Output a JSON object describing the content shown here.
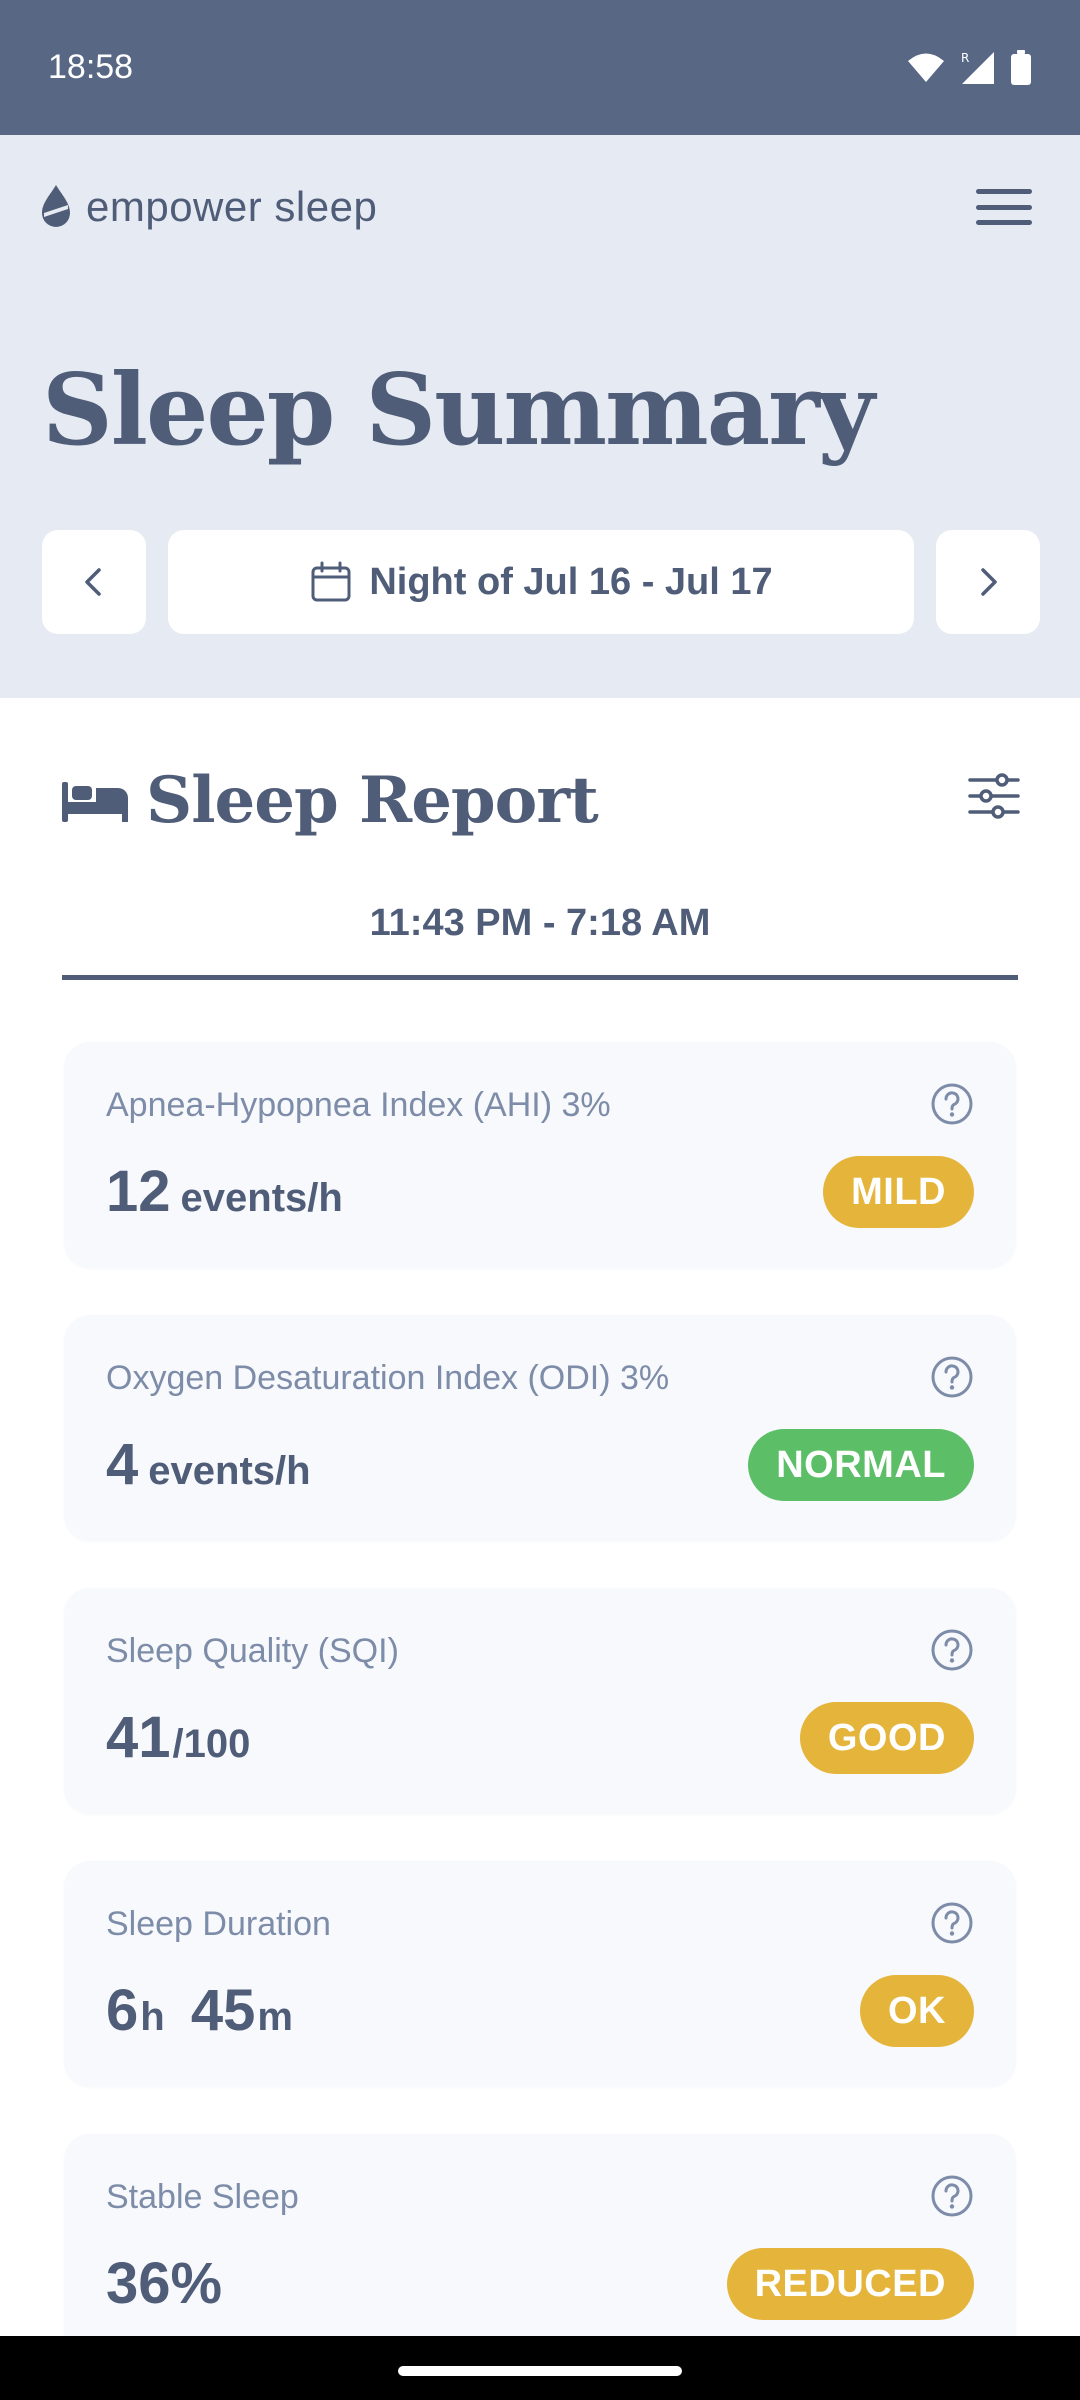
{
  "status_bar": {
    "time": "18:58"
  },
  "brand": {
    "name": "empower sleep"
  },
  "page": {
    "title": "Sleep Summary"
  },
  "date_nav": {
    "label": "Night of Jul 16 - Jul 17"
  },
  "report": {
    "title": "Sleep Report",
    "time_range": "11:43 PM - 7:18 AM"
  },
  "metrics": [
    {
      "label": "Apnea-Hypopnea Index (AHI) 3%",
      "value": "12",
      "unit": "events/h",
      "badge": "MILD",
      "badge_color": "#e5b43a"
    },
    {
      "label": "Oxygen Desaturation Index (ODI) 3%",
      "value": "4",
      "unit": "events/h",
      "badge": "NORMAL",
      "badge_color": "#5cbf67"
    },
    {
      "label": "Sleep Quality (SQI)",
      "value": "41",
      "unit": "/100",
      "badge": "GOOD",
      "badge_color": "#e5b43a"
    },
    {
      "label": "Sleep Duration",
      "value_h": "6",
      "unit_h": "h",
      "value_m": "45",
      "unit_m": "m",
      "badge": "OK",
      "badge_color": "#e5b43a"
    },
    {
      "label": "Stable Sleep",
      "value": "36%",
      "badge": "REDUCED",
      "badge_color": "#e5b43a"
    }
  ],
  "colors": {
    "status_bar": "#576784",
    "hero_bg": "#e6ebf3",
    "primary_text": "#4f5d78",
    "muted_text": "#7d8ca8",
    "card_bg": "#f8f9fc"
  }
}
